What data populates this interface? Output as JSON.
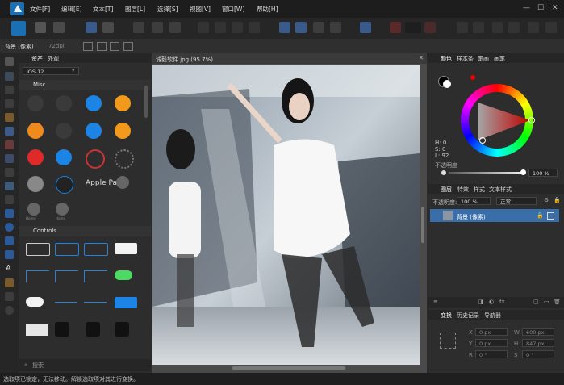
{
  "menu": [
    "文件[F]",
    "编辑[E]",
    "文本[T]",
    "图层[L]",
    "选择[S]",
    "视图[V]",
    "窗口[W]",
    "帮助[H]"
  ],
  "context": {
    "layer_name": "背景 (像素)",
    "dpi": "72dpi"
  },
  "assets_panel": {
    "tabs": [
      "资产",
      "外观"
    ],
    "category": "iOS 12",
    "sections": [
      "Misc",
      "Controls"
    ],
    "misc_labels": {
      "pair1": "Home",
      "pair2": "Home",
      "pair3": "Apple Pay"
    },
    "search_placeholder": "搜索"
  },
  "document": {
    "tab_title": "诚毅软件.jpg (95.7%)"
  },
  "color_panel": {
    "tabs": [
      "颜色",
      "样本条",
      "笔画",
      "画笔"
    ],
    "h": "H: 0",
    "s": "S: 0",
    "l": "L: 92",
    "opacity_label": "不透明度",
    "opacity_value": "100 %"
  },
  "layers_panel": {
    "tabs": [
      "图层",
      "特效",
      "样式",
      "文本样式"
    ],
    "opacity_label": "不透明度:",
    "opacity_value": "100 %",
    "blend": "正常",
    "layer_name": "背景 (像素)"
  },
  "transform_panel": {
    "tabs": [
      "变换",
      "历史记录",
      "导航器"
    ],
    "x": "0 px",
    "y": "0 px",
    "w": "600 px",
    "h": "847 px",
    "r": "0 °",
    "s": "0 °",
    "labels": {
      "x": "X",
      "y": "Y",
      "w": "W",
      "h": "H",
      "r": "R",
      "s": "S"
    }
  },
  "status_text": "选取项已锁定，无法移动。解锁选取项对其进行变换。",
  "colors": {
    "accent": "#1b6fb3",
    "selection": "#3a6ea8"
  }
}
